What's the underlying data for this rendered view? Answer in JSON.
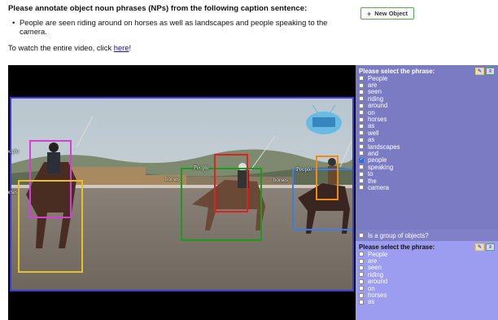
{
  "header": {
    "instruction": "Please annotate object noun phrases (NPs) from the following caption sentence:",
    "caption": "People are seen riding around on horses as well as landscapes and people speaking to the camera.",
    "watch_prefix": "To watch the entire video, click ",
    "watch_link": "here",
    "watch_suffix": "!"
  },
  "toolbar": {
    "new_object_label": "New Object"
  },
  "video": {
    "labels": {
      "left_people": "People",
      "left_horses": "horses",
      "left_clip": "pe",
      "mid_horses": "horses",
      "mid_people": "People",
      "right_horses": "horses",
      "right_people": "People"
    }
  },
  "panel1": {
    "heading": "Please select the phrase:",
    "options": [
      {
        "label": "People",
        "checked": false
      },
      {
        "label": "are",
        "checked": false
      },
      {
        "label": "seen",
        "checked": false
      },
      {
        "label": "riding",
        "checked": false
      },
      {
        "label": "around",
        "checked": false
      },
      {
        "label": "on",
        "checked": false
      },
      {
        "label": "horses",
        "checked": false
      },
      {
        "label": "as",
        "checked": false
      },
      {
        "label": "well",
        "checked": false
      },
      {
        "label": "as",
        "checked": false
      },
      {
        "label": "landscapes",
        "checked": false
      },
      {
        "label": "and",
        "checked": false
      },
      {
        "label": "people",
        "checked": true
      },
      {
        "label": "speaking",
        "checked": false
      },
      {
        "label": "to",
        "checked": false
      },
      {
        "label": "the",
        "checked": false
      },
      {
        "label": "camera",
        "checked": false
      }
    ],
    "group_label": "Is a group of objects?"
  },
  "panel2": {
    "heading": "Please select the phrase:",
    "options": [
      {
        "label": "People",
        "checked": false
      },
      {
        "label": "are",
        "checked": false
      },
      {
        "label": "seen",
        "checked": false
      },
      {
        "label": "riding",
        "checked": false
      },
      {
        "label": "around",
        "checked": false
      },
      {
        "label": "on",
        "checked": false
      },
      {
        "label": "horses",
        "checked": false
      },
      {
        "label": "as",
        "checked": false
      }
    ]
  },
  "colors": {
    "panel1_bg": "#7b7bc4",
    "panel2_bg": "#9c9cf0",
    "frame_border": "#3b3bdc",
    "box_magenta": "#d63fd6",
    "box_yellow": "#e6c229",
    "box_green": "#1f9a1f",
    "box_red": "#e02020",
    "box_orange": "#f08a1a",
    "box_blue": "#3b7de0"
  }
}
